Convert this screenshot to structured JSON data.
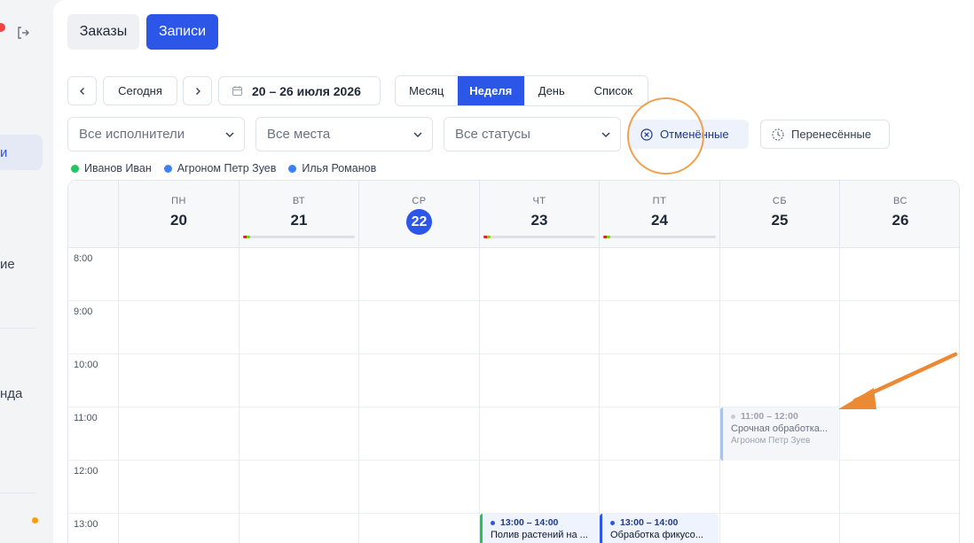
{
  "sidebar": {
    "items": [
      {
        "label": "и"
      },
      {
        "label": "ие"
      },
      {
        "label": "нда"
      }
    ]
  },
  "header": {
    "tabs": [
      {
        "label": "Заказы"
      },
      {
        "label": "Записи"
      }
    ]
  },
  "toolbar": {
    "today_label": "Сегодня",
    "date_range": "20 – 26 июля 2026",
    "views": [
      {
        "label": "Месяц"
      },
      {
        "label": "Неделя"
      },
      {
        "label": "День"
      },
      {
        "label": "Список"
      }
    ]
  },
  "filters": {
    "performers": "Все исполнители",
    "places": "Все места",
    "statuses": "Все статусы",
    "cancelled": "Отменённые",
    "rescheduled": "Перенесённые"
  },
  "legend": [
    {
      "name": "Иванов Иван",
      "color": "#22c55e"
    },
    {
      "name": "Агроном Петр Зуев",
      "color": "#3b82f6"
    },
    {
      "name": "Илья Романов",
      "color": "#3b82f6"
    }
  ],
  "calendar": {
    "days": [
      {
        "dow": "ПН",
        "num": "20"
      },
      {
        "dow": "ВТ",
        "num": "21"
      },
      {
        "dow": "СР",
        "num": "22"
      },
      {
        "dow": "ЧТ",
        "num": "23"
      },
      {
        "dow": "ПТ",
        "num": "24"
      },
      {
        "dow": "СБ",
        "num": "25"
      },
      {
        "dow": "ВС",
        "num": "26"
      }
    ],
    "times": [
      "8:00",
      "9:00",
      "10:00",
      "11:00",
      "12:00",
      "13:00"
    ],
    "events": [
      {
        "time": "11:00 – 12:00",
        "title": "Срочная обработка...",
        "who": "Агроном Петр Зуев"
      },
      {
        "time": "13:00 – 14:00",
        "title": "Полив растений на ..."
      },
      {
        "time": "13:00 – 14:00",
        "title": "Обработка фикусо..."
      }
    ]
  },
  "colors": {
    "accent": "#2b56e8",
    "annotation": "#f0a050"
  }
}
